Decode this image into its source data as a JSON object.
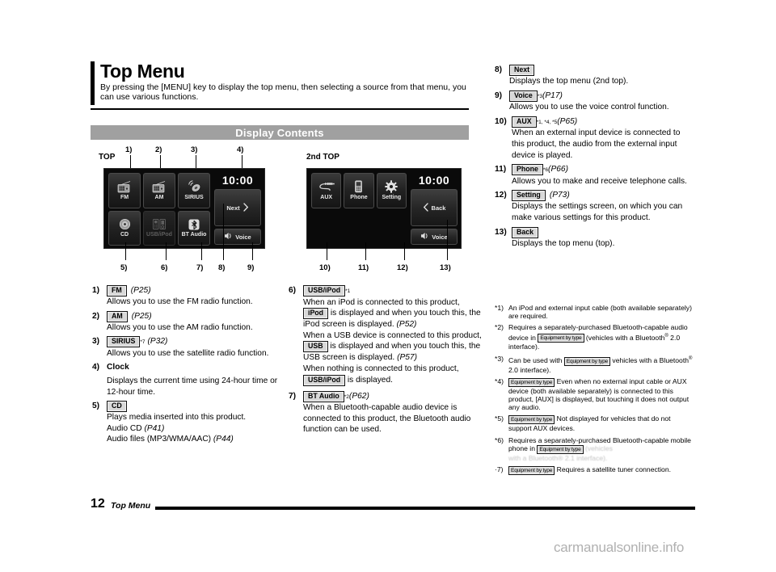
{
  "header": {
    "title": "Top Menu",
    "intro": "By pressing the [MENU] key to display the top menu, then selecting a source from that menu, you can use various functions."
  },
  "section_bar": {
    "label": "Display Contents"
  },
  "figures": {
    "top": {
      "label": "TOP",
      "clock": "10:00",
      "tiles": [
        {
          "label": "FM",
          "icon": "radio-icon",
          "dim": false
        },
        {
          "label": "AM",
          "icon": "radio-icon",
          "dim": false
        },
        {
          "label": "SIRIUS",
          "icon": "satellite-icon",
          "dim": false
        },
        {
          "label": "CD",
          "icon": "disc-icon",
          "dim": false
        },
        {
          "label": "USB/iPod",
          "icon": "usb-device-icon",
          "dim": true
        },
        {
          "label": "BT Audio",
          "icon": "bluetooth-icon",
          "dim": false
        }
      ],
      "side_buttons": [
        {
          "label": "Next",
          "icon": "chevron-right-icon"
        },
        {
          "label": "Voice",
          "icon": "voice-icon"
        }
      ],
      "callouts_top": [
        "1)",
        "2)",
        "3)",
        "4)"
      ],
      "callouts_bottom": [
        "5)",
        "6)",
        "7)",
        "8)",
        "9)"
      ]
    },
    "second_top": {
      "label": "2nd TOP",
      "clock": "10:00",
      "tiles": [
        {
          "label": "AUX",
          "icon": "aux-plug-icon",
          "dim": false
        },
        {
          "label": "Phone",
          "icon": "mobile-phone-icon",
          "dim": false
        },
        {
          "label": "Setting",
          "icon": "gear-icon",
          "dim": false
        }
      ],
      "side_buttons": [
        {
          "label": "Back",
          "icon": "chevron-left-icon"
        },
        {
          "label": "Voice",
          "icon": "voice-icon"
        }
      ],
      "callouts_bottom": [
        "10)",
        "11)",
        "12)",
        "13)"
      ]
    }
  },
  "items": {
    "i1": {
      "num": "1)",
      "key": "FM",
      "page": "(P25)",
      "desc": "Allows you to use the FM radio function."
    },
    "i2": {
      "num": "2)",
      "key": "AM",
      "page": "(P25)",
      "desc": "Allows you to use the AM radio function."
    },
    "i3": {
      "num": "3)",
      "key": "SIRIUS",
      "sup": "*7",
      "page": "(P32)",
      "desc": "Allows you to use the satellite radio function."
    },
    "i4": {
      "num": "4)",
      "title": "Clock",
      "desc": "Displays the current time using 24-hour time or 12-hour time."
    },
    "i5": {
      "num": "5)",
      "key": "CD",
      "desc": "Plays media inserted into this product.",
      "line2_a": "Audio CD ",
      "line2_b": "(P41)",
      "line3_a": "Audio files (MP3/WMA/AAC) ",
      "line3_b": "(P44)"
    },
    "i6": {
      "num": "6)",
      "key": "USB/iPod",
      "sup": "*1",
      "p1_a": "When an iPod is connected to this product, ",
      "p1_key": "iPod",
      "p1_b": " is displayed and when you touch this, the iPod screen is displayed. ",
      "p1_page": "(P52)",
      "p2_a": "When a USB device is connected to this product, ",
      "p2_key": "USB",
      "p2_b": " is displayed and when you touch this, the USB screen is displayed. ",
      "p2_page": "(P57)",
      "p3_a": "When nothing is connected to this product, ",
      "p3_key": "USB/iPod",
      "p3_b": " is displayed."
    },
    "i7": {
      "num": "7)",
      "key": "BT Audio",
      "sup": "*2",
      "page": "(P62)",
      "desc": "When a Bluetooth-capable audio device is connected to this product, the Bluetooth audio function can be used."
    },
    "i8": {
      "num": "8)",
      "key": "Next",
      "desc": "Displays the top menu (2nd top)."
    },
    "i9": {
      "num": "9)",
      "key": "Voice",
      "sup": "*3",
      "page": "(P17)",
      "desc": "Allows you to use the voice control function."
    },
    "i10": {
      "num": "10)",
      "key": "AUX",
      "sup": "*1, *4, *5",
      "page": "(P65)",
      "desc": "When an external input device is connected to this product, the audio from the external input device is played."
    },
    "i11": {
      "num": "11)",
      "key": "Phone",
      "sup": "*6",
      "page": "(P66)",
      "desc": "Allows you to make and receive telephone calls."
    },
    "i12": {
      "num": "12)",
      "key": "Setting",
      "page": "(P73)",
      "desc": "Displays the settings screen, on which you can make various settings for this product."
    },
    "i13": {
      "num": "13)",
      "key": "Back",
      "desc": "Displays the top menu (top)."
    }
  },
  "footnotes": [
    {
      "mark": "*1)",
      "parts": [
        {
          "t": "An iPod and external input cable (both available separately) are required."
        }
      ]
    },
    {
      "mark": "*2)",
      "parts": [
        {
          "t": "Requires a separately-purchased Bluetooth-capable audio device in "
        },
        {
          "k": "Equipment by type"
        },
        {
          "t": " (vehicles with a Bluetooth"
        },
        {
          "sup": "®"
        },
        {
          "t": " 2.0 interface)."
        }
      ]
    },
    {
      "mark": "*3)",
      "parts": [
        {
          "t": "Can be used with "
        },
        {
          "k": "Equipment by type"
        },
        {
          "t": "  vehicles with a Bluetooth"
        },
        {
          "sup": "®"
        },
        {
          "t": " 2.0 interface)."
        }
      ]
    },
    {
      "mark": "*4)",
      "parts": [
        {
          "k": "Equipment by type"
        },
        {
          "t": " Even when no external input cable or AUX device (both available separately) is connected to this product, [AUX] is displayed, but touching it does not output any audio."
        }
      ]
    },
    {
      "mark": "*5)",
      "parts": [
        {
          "k": "Equipment by type"
        },
        {
          "t": " Not displayed for vehicles that do not support AUX devices."
        }
      ]
    },
    {
      "mark": "*6)",
      "parts": [
        {
          "t": "Requires a separately-purchased Bluetooth-capable mobile phone in "
        },
        {
          "k": "Equipment by type"
        },
        {
          "faded": " (vehicles"
        },
        {
          "faded_line": "with a Bluetooth® 2.1 interface)."
        }
      ]
    },
    {
      "mark": "·7)",
      "parts": [
        {
          "k": "Equipment by type"
        },
        {
          "t": " Requires a satellite tuner connection."
        }
      ]
    }
  ],
  "footer": {
    "page_number": "12",
    "section": "Top Menu",
    "watermark": "carmanualsonline.info"
  }
}
